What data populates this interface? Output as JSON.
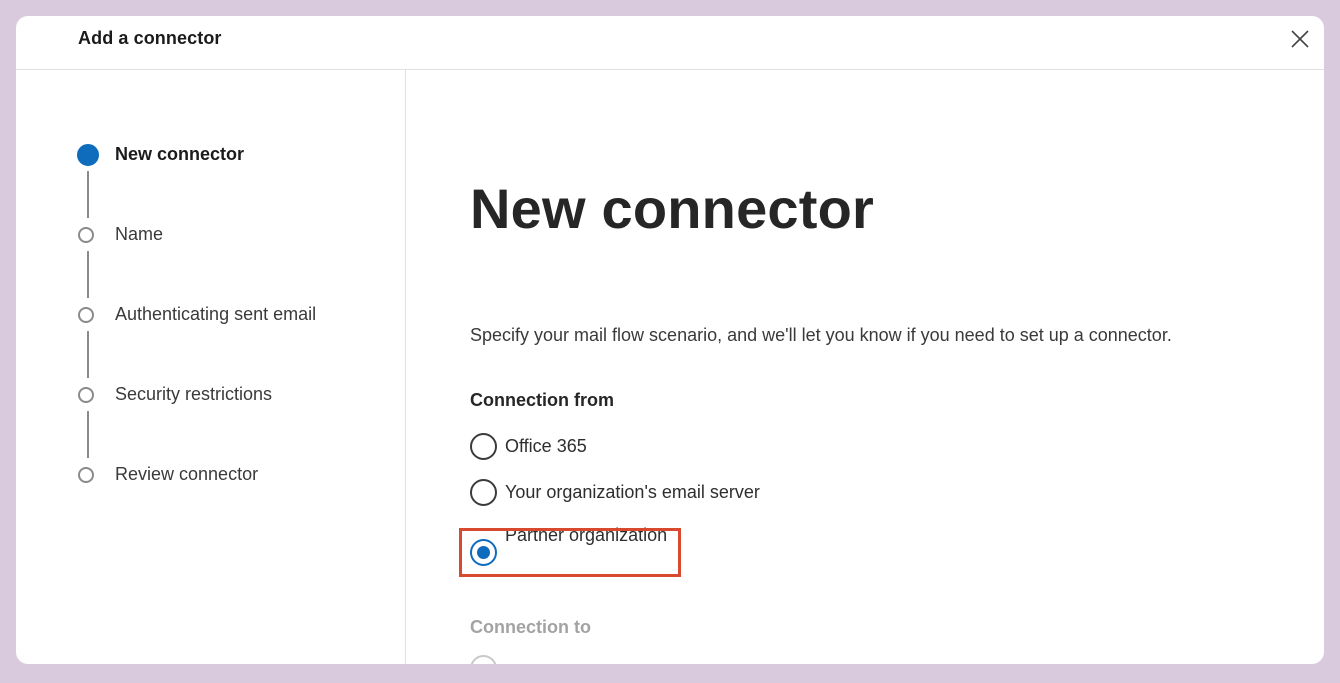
{
  "dialog": {
    "title": "Add a connector",
    "close_icon": "close-icon"
  },
  "steps": [
    {
      "label": "New connector",
      "state": "current"
    },
    {
      "label": "Name",
      "state": "pending"
    },
    {
      "label": "Authenticating sent email",
      "state": "pending"
    },
    {
      "label": "Security restrictions",
      "state": "pending"
    },
    {
      "label": "Review connector",
      "state": "pending"
    }
  ],
  "main": {
    "title": "New connector",
    "description": "Specify your mail flow scenario, and we'll let you know if you need to set up a connector.",
    "connection_from": {
      "label": "Connection from",
      "options": [
        {
          "label": "Office 365",
          "checked": false
        },
        {
          "label": "Your organization's email server",
          "checked": false
        },
        {
          "label": "Partner organization",
          "checked": true
        }
      ]
    },
    "connection_to": {
      "label": "Connection to"
    }
  },
  "colors": {
    "accent": "#0f6cbd",
    "highlight": "#d84a30",
    "frame": "#d9cbdd"
  }
}
